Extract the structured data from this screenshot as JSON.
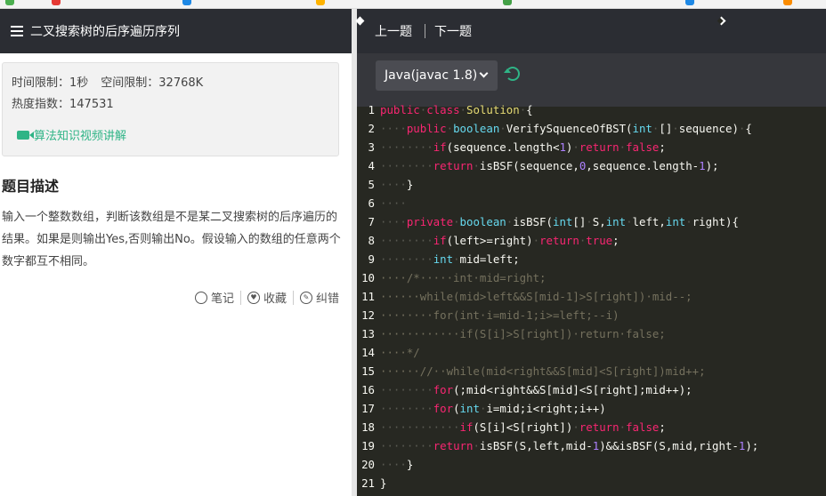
{
  "problem": {
    "title": "二叉搜索树的后序遍历序列",
    "time_limit": "时间限制：1秒",
    "space_limit": "空间限制：32768K",
    "hot_index": "热度指数：147531",
    "video_link": "算法知识视频讲解",
    "desc_title": "题目描述",
    "desc_text": "输入一个整数数组，判断该数组是不是某二叉搜索树的后序遍历的结果。如果是则输出Yes,否则输出No。假设输入的数组的任意两个数字都互不相同。",
    "actions": {
      "note": "笔记",
      "collect": "收藏",
      "report": "纠错"
    }
  },
  "editor": {
    "prev": "上一题",
    "next": "下一题",
    "language": "Java(javac 1.8)",
    "code_lines": [
      "public class Solution {",
      "    public boolean VerifySquenceOfBST(int [] sequence) {",
      "        if(sequence.length<1) return false;",
      "        return isBSF(sequence,0,sequence.length-1);",
      "    }",
      "    ",
      "    private boolean isBSF(int[] S,int left,int right){",
      "        if(left>=right) return true;",
      "        int mid=left;",
      "    /*     int mid=right;",
      "      while(mid>left&&S[mid-1]>S[right]) mid--;",
      "        for(int i=mid-1;i>=left;--i)",
      "            if(S[i]>S[right]) return false;",
      "    */",
      "      //  while(mid<right&&S[mid]<S[right])mid++;",
      "        for(;mid<right&&S[mid]<S[right];mid++);",
      "        for(int i=mid;i<right;i++)",
      "            if(S[i]<S[right]) return false;",
      "        return isBSF(S,left,mid-1)&&isBSF(S,mid,right-1);",
      "    }",
      "}"
    ]
  },
  "colors": {
    "accent_green": "#2fb486",
    "editor_bg": "#272822",
    "header_bg": "#2b2d33"
  }
}
